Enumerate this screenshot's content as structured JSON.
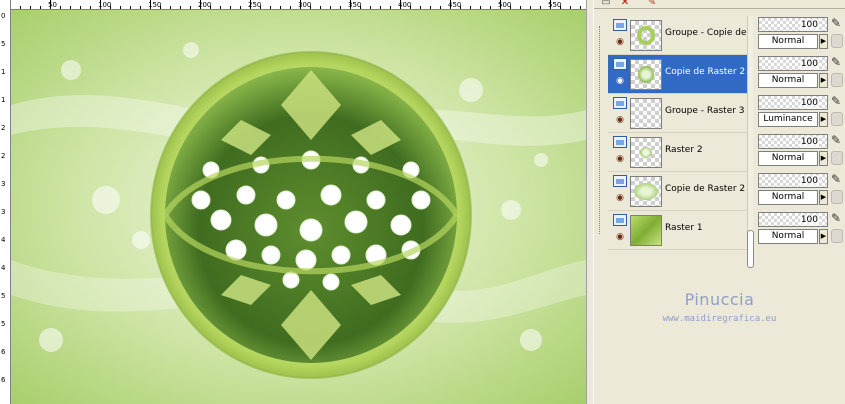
{
  "rulers": {
    "top_labels": [
      "0",
      "50",
      "100",
      "150",
      "200",
      "250",
      "300",
      "350",
      "400",
      "450",
      "500",
      "550"
    ],
    "left_labels": [
      "0",
      "5",
      "1",
      "1",
      "2",
      "2",
      "3",
      "3",
      "4",
      "4",
      "5",
      "5",
      "6",
      "6"
    ]
  },
  "toolbar": {
    "icons": [
      "new-layer-icon",
      "delete-layer-icon",
      "brush-icon"
    ]
  },
  "layers": [
    {
      "name": "Groupe - Copie de l",
      "kind": "group",
      "selected": false,
      "thumb": "wreath",
      "opacity": "100",
      "blend": "Normal"
    },
    {
      "name": "Copie de Raster 2",
      "kind": "raster",
      "selected": true,
      "thumb": "flowers",
      "opacity": "100",
      "blend": "Normal"
    },
    {
      "name": "Groupe - Raster 3",
      "kind": "group",
      "selected": false,
      "thumb": "empty",
      "opacity": "100",
      "blend": "Luminance"
    },
    {
      "name": "Raster 2",
      "kind": "raster",
      "selected": false,
      "thumb": "flowers-small",
      "opacity": "100",
      "blend": "Normal"
    },
    {
      "name": "Copie de Raster 2",
      "kind": "raster",
      "selected": false,
      "thumb": "flowers",
      "opacity": "100",
      "blend": "Normal"
    },
    {
      "name": "Raster 1",
      "kind": "raster",
      "selected": false,
      "thumb": "green",
      "opacity": "100",
      "blend": "Normal"
    }
  ],
  "watermark": {
    "title": "Pinuccia",
    "url": "www.maidiregrafica.eu"
  },
  "colors": {
    "selection": "#316ac5",
    "panel": "#ece9d8",
    "accent_green": "#a8cf5a",
    "watermark": "#8ea0c8"
  }
}
